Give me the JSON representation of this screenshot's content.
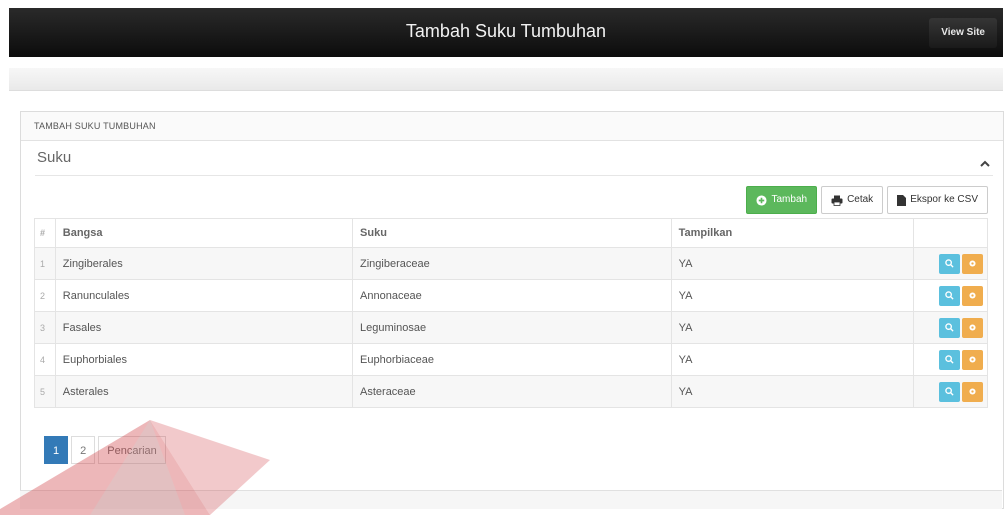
{
  "header": {
    "title": "Tambah Suku Tumbuhan",
    "view_site": "View Site"
  },
  "panel": {
    "heading": "TAMBAH SUKU TUMBUHAN",
    "section_title": "Suku"
  },
  "toolbar": {
    "add": "Tambah",
    "print": "Cetak",
    "export": "Ekspor ke CSV"
  },
  "colors": {
    "add": "#5cb85c",
    "view": "#5bc0de",
    "edit": "#f0ad4e",
    "page_active": "#337ab7"
  },
  "table": {
    "headers": {
      "num": "#",
      "bangsa": "Bangsa",
      "suku": "Suku",
      "tampilkan": "Tampilkan"
    },
    "rows": [
      {
        "num": "1",
        "bangsa": "Zingiberales",
        "suku": "Zingiberaceae",
        "tampilkan": "YA"
      },
      {
        "num": "2",
        "bangsa": "Ranunculales",
        "suku": "Annonaceae",
        "tampilkan": "YA"
      },
      {
        "num": "3",
        "bangsa": "Fasales",
        "suku": "Leguminosae",
        "tampilkan": "YA"
      },
      {
        "num": "4",
        "bangsa": "Euphorbiales",
        "suku": "Euphorbiaceae",
        "tampilkan": "YA"
      },
      {
        "num": "5",
        "bangsa": "Asterales",
        "suku": "Asteraceae",
        "tampilkan": "YA"
      }
    ]
  },
  "pagination": {
    "page1": "1",
    "page2": "2",
    "search": "Pencarian"
  }
}
